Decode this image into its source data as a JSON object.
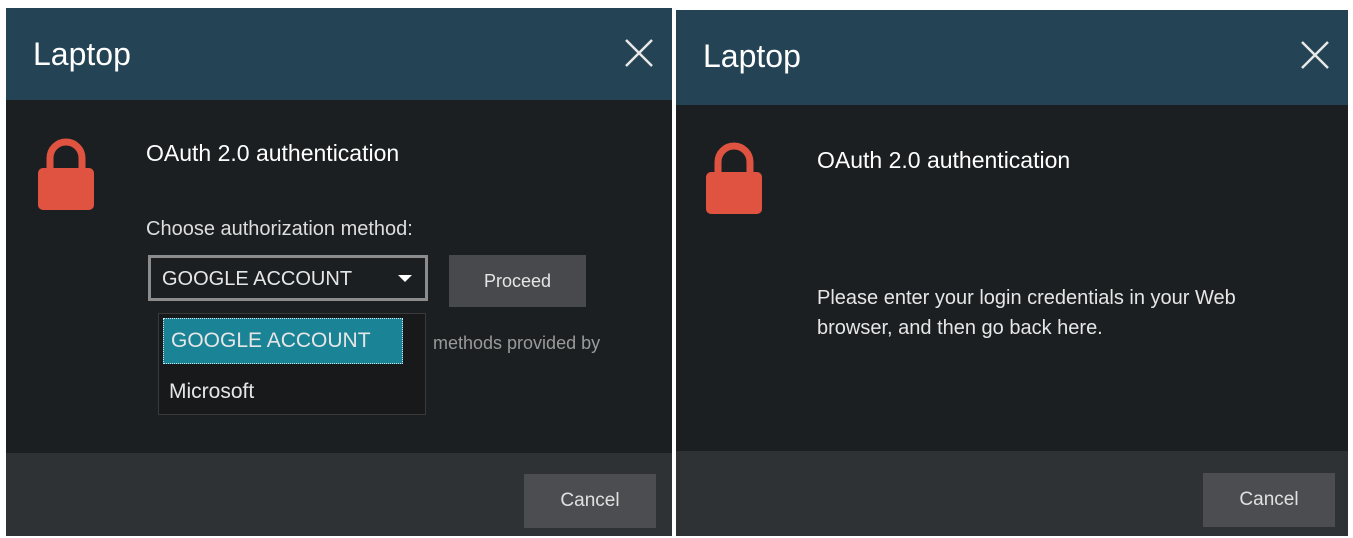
{
  "dialog_left": {
    "title": "Laptop",
    "heading": "OAuth 2.0 authentication",
    "choose_label": "Choose authorization method:",
    "selected_method": "GOOGLE ACCOUNT",
    "proceed_label": "Proceed",
    "info_text_visible": "methods provided by",
    "dropdown_options": [
      "GOOGLE ACCOUNT",
      "Microsoft"
    ],
    "cancel_label": "Cancel"
  },
  "dialog_right": {
    "title": "Laptop",
    "heading": "OAuth 2.0 authentication",
    "message": "Please enter your login credentials in your Web browser, and then go back here.",
    "cancel_label": "Cancel"
  },
  "colors": {
    "titlebar": "#244455",
    "body": "#1b1f22",
    "footer": "#2f3235",
    "lock": "#e05340",
    "selected_option": "#1a8496"
  },
  "icons": [
    "close-icon",
    "lock-icon",
    "chevron-down-icon"
  ]
}
